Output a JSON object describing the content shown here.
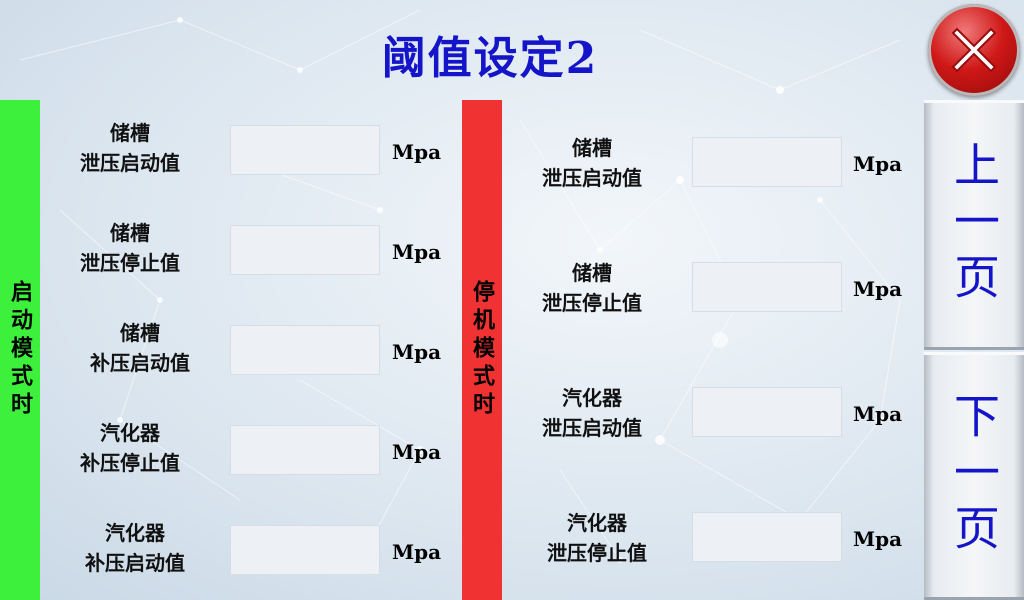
{
  "title": "阈值设定2",
  "left_panel": {
    "mode_label": "启动模式时",
    "rows": [
      {
        "line1": "储槽",
        "line2": "泄压启动值",
        "value": "",
        "unit": "Mpa"
      },
      {
        "line1": "储槽",
        "line2": "泄压停止值",
        "value": "",
        "unit": "Mpa"
      },
      {
        "line1": "储槽",
        "line2": "补压启动值",
        "value": "",
        "unit": "Mpa"
      },
      {
        "line1": "汽化器",
        "line2": "补压停止值",
        "value": "",
        "unit": "Mpa"
      },
      {
        "line1": "汽化器",
        "line2": "补压启动值",
        "value": "",
        "unit": "Mpa"
      }
    ]
  },
  "right_panel": {
    "mode_label": "停机模式时",
    "rows": [
      {
        "line1": "储槽",
        "line2": "泄压启动值",
        "value": "",
        "unit": "Mpa"
      },
      {
        "line1": "储槽",
        "line2": "泄压停止值",
        "value": "",
        "unit": "Mpa"
      },
      {
        "line1": "汽化器",
        "line2": "泄压启动值",
        "value": "",
        "unit": "Mpa"
      },
      {
        "line1": "汽化器",
        "line2": "泄压停止值",
        "value": "",
        "unit": "Mpa"
      }
    ]
  },
  "nav": {
    "prev_label": "上一页",
    "next_label": "下一页",
    "close_icon": "close-x-icon"
  },
  "colors": {
    "title": "#1414c8",
    "start_mode_bar": "#3cf03c",
    "stop_mode_bar": "#f03232",
    "close_button": "#d01818"
  }
}
